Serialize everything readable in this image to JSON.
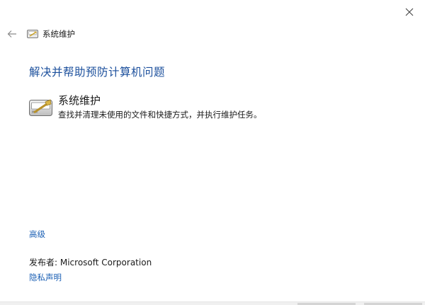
{
  "window": {
    "close_label": "✕"
  },
  "nav": {
    "back_icon": "back-arrow-icon",
    "title": "系统维护"
  },
  "main": {
    "heading": "解决并帮助预防计算机问题",
    "task": {
      "icon": "system-maintenance-icon",
      "title": "系统维护",
      "description": "查找并清理未使用的文件和快捷方式，并执行维护任务。"
    }
  },
  "footer": {
    "advanced_label": "高级",
    "publisher_text": "发布者:  Microsoft Corporation",
    "privacy_label": "隐私声明"
  },
  "colors": {
    "heading": "#1b4f9c",
    "link": "#1a5fb4",
    "background": "#ffffff"
  }
}
